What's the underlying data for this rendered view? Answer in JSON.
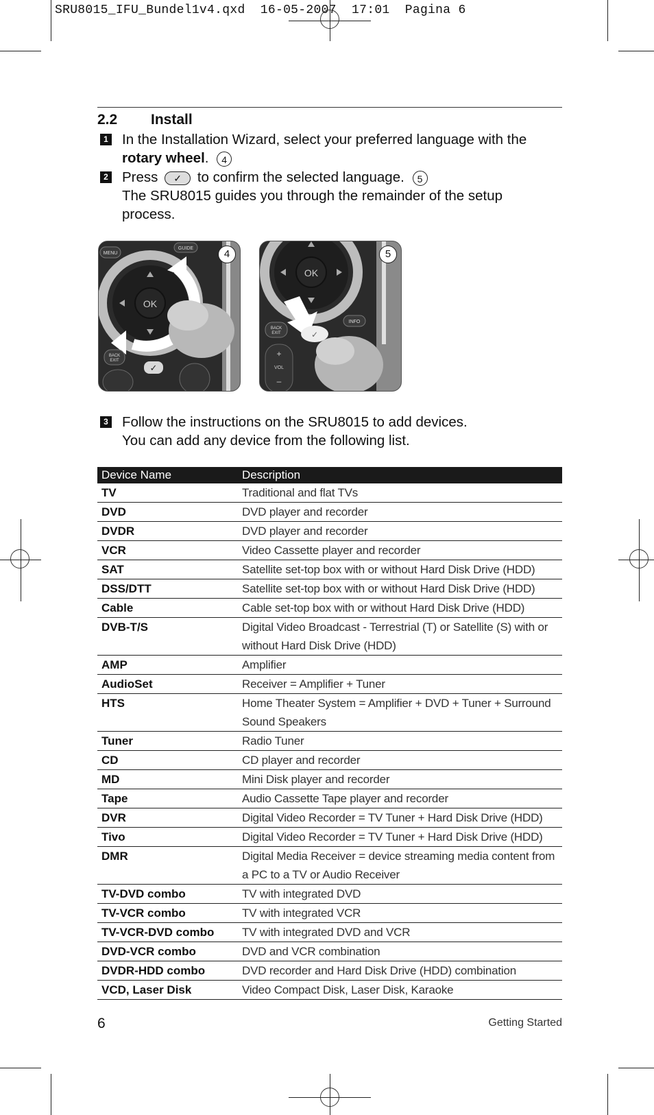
{
  "slug": {
    "filename": "SRU8015_IFU_Bundel1v4.qxd",
    "date": "16-05-2007",
    "time": "17:01",
    "page_label": "Pagina 6"
  },
  "section": {
    "number": "2.2",
    "title": "Install"
  },
  "steps": [
    {
      "num": "1",
      "text_before": "In the Installation Wizard, select your preferred language with the ",
      "bold": "rotary wheel",
      "text_after": ".",
      "figure_ref": "4"
    },
    {
      "num": "2",
      "text_before": "Press",
      "button_icon": "check-button-icon",
      "text_after": "to confirm the selected language.",
      "figure_ref": "5",
      "line2": "The SRU8015 guides you through the remainder of the setup process."
    },
    {
      "num": "3",
      "line1": "Follow the instructions on the SRU8015 to add devices.",
      "line2": "You can add any device from the following list."
    }
  ],
  "figures": [
    {
      "label": "4",
      "buttons": [
        "MENU",
        "GUIDE",
        "OK",
        "BACK EXIT"
      ]
    },
    {
      "label": "5",
      "buttons": [
        "OK",
        "BACK EXIT",
        "INFO",
        "VOL"
      ]
    }
  ],
  "table": {
    "headers": [
      "Device Name",
      "Description"
    ],
    "rows": [
      {
        "name": "TV",
        "desc": "Traditional and flat TVs"
      },
      {
        "name": "DVD",
        "desc": "DVD player and recorder"
      },
      {
        "name": "DVDR",
        "desc": "DVD player and recorder"
      },
      {
        "name": "VCR",
        "desc": "Video Cassette player and recorder"
      },
      {
        "name": "SAT",
        "desc": "Satellite set-top box with or without Hard Disk Drive (HDD)"
      },
      {
        "name": "DSS/DTT",
        "desc": "Satellite set-top box with or without Hard Disk Drive (HDD)"
      },
      {
        "name": "Cable",
        "desc": "Cable set-top box with or without Hard Disk Drive (HDD)"
      },
      {
        "name": "DVB-T/S",
        "desc": "Digital Video Broadcast - Terrestrial (T) or Satellite (S) with or without Hard Disk Drive (HDD)"
      },
      {
        "name": "AMP",
        "desc": "Amplifier"
      },
      {
        "name": "AudioSet",
        "desc": "Receiver = Amplifier + Tuner"
      },
      {
        "name": "HTS",
        "desc": "Home Theater System = Amplifier + DVD + Tuner + Surround Sound Speakers"
      },
      {
        "name": "Tuner",
        "desc": "Radio Tuner"
      },
      {
        "name": "CD",
        "desc": "CD player and recorder"
      },
      {
        "name": "MD",
        "desc": "Mini Disk player and recorder"
      },
      {
        "name": "Tape",
        "desc": "Audio Cassette Tape player and recorder"
      },
      {
        "name": "DVR",
        "desc": "Digital Video Recorder = TV Tuner + Hard Disk Drive (HDD)"
      },
      {
        "name": "Tivo",
        "desc": "Digital Video Recorder = TV Tuner + Hard Disk Drive (HDD)"
      },
      {
        "name": "DMR",
        "desc": "Digital Media Receiver = device streaming media content from a PC to a TV or Audio Receiver"
      },
      {
        "name": "TV-DVD combo",
        "desc": "TV with integrated DVD"
      },
      {
        "name": "TV-VCR combo",
        "desc": "TV with integrated VCR"
      },
      {
        "name": "TV-VCR-DVD combo",
        "desc": "TV with integrated DVD and VCR"
      },
      {
        "name": "DVD-VCR combo",
        "desc": "DVD and VCR combination"
      },
      {
        "name": "DVDR-HDD combo",
        "desc": "DVD recorder and Hard Disk Drive (HDD) combination"
      },
      {
        "name": "VCD, Laser Disk",
        "desc": "Video Compact Disk, Laser Disk, Karaoke"
      }
    ]
  },
  "footer": {
    "page_number": "6",
    "section_name": "Getting Started"
  }
}
